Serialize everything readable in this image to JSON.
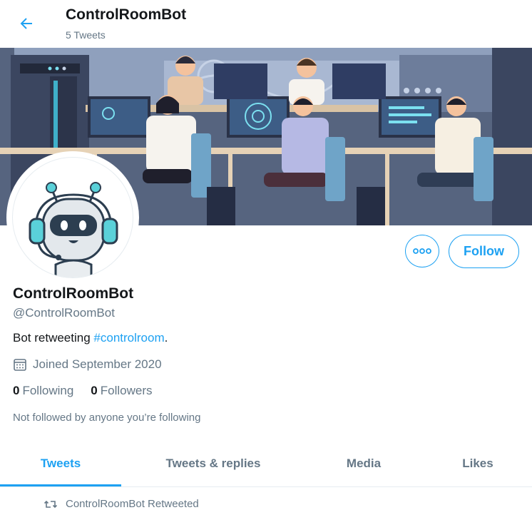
{
  "header": {
    "title": "ControlRoomBot",
    "tweet_count": "5 Tweets"
  },
  "profile": {
    "name": "ControlRoomBot",
    "handle": "@ControlRoomBot",
    "bio_prefix": "Bot retweeting ",
    "bio_hashtag": "#controlroom",
    "bio_suffix": ".",
    "joined": "Joined September 2020",
    "following_count": "0",
    "following_label": "Following",
    "followers_count": "0",
    "followers_label": "Followers",
    "not_followed": "Not followed by anyone you’re following"
  },
  "buttons": {
    "follow_label": "Follow",
    "more_icon": "ellipsis-icon",
    "back_icon": "arrow-left-icon"
  },
  "tabs": [
    {
      "label": "Tweets",
      "active": true
    },
    {
      "label": "Tweets & replies",
      "active": false
    },
    {
      "label": "Media",
      "active": false
    },
    {
      "label": "Likes",
      "active": false
    }
  ],
  "timeline": {
    "retweet_notice": "ControlRoomBot Retweeted"
  },
  "colors": {
    "accent": "#1da1f2",
    "text": "#14171a",
    "muted": "#657786",
    "border": "#e6ecf0"
  }
}
